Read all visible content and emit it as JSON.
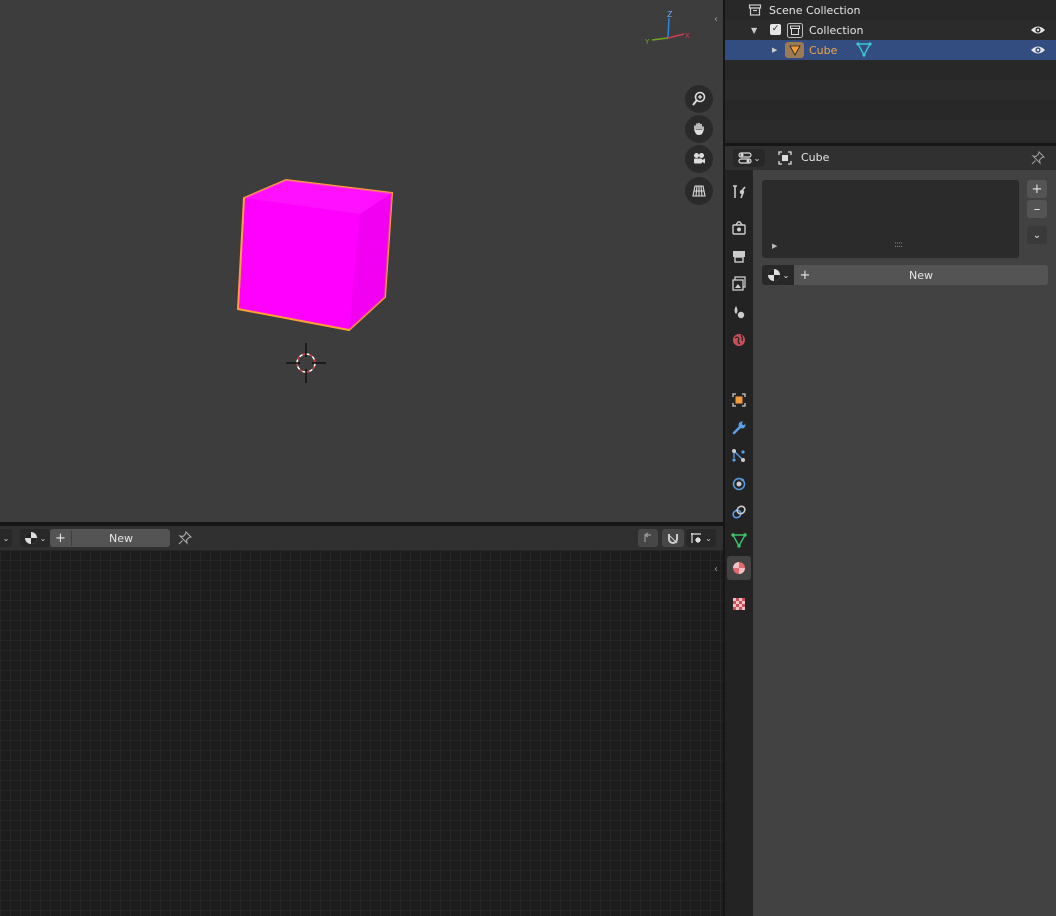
{
  "outliner": {
    "scene_collection": "Scene Collection",
    "collection": "Collection",
    "cube": "Cube"
  },
  "properties": {
    "object_name": "Cube",
    "material_new_label": "New",
    "slot_add": "+",
    "slot_remove": "–"
  },
  "shader_editor": {
    "new_label": "New"
  },
  "colors": {
    "cube_face": "#ff00ff",
    "selection_outline": "#ffa033",
    "accent_selected_row": "#334d80",
    "cube_name_text": "#f3a54b"
  },
  "icons": {
    "viewport_nav": [
      "zoom-icon",
      "hand-pan-icon",
      "camera-icon",
      "perspective-grid-icon"
    ],
    "property_tabs": [
      "tool-icon",
      "render-icon",
      "output-icon",
      "view-layer-icon",
      "scene-icon",
      "world-icon",
      "object-icon",
      "modifier-icon",
      "particles-icon",
      "physics-icon",
      "constraints-icon",
      "object-data-icon",
      "material-icon",
      "texture-icon"
    ]
  },
  "gizmo": {
    "z_label": "Z",
    "y_label": "Y",
    "x_label": "X"
  }
}
